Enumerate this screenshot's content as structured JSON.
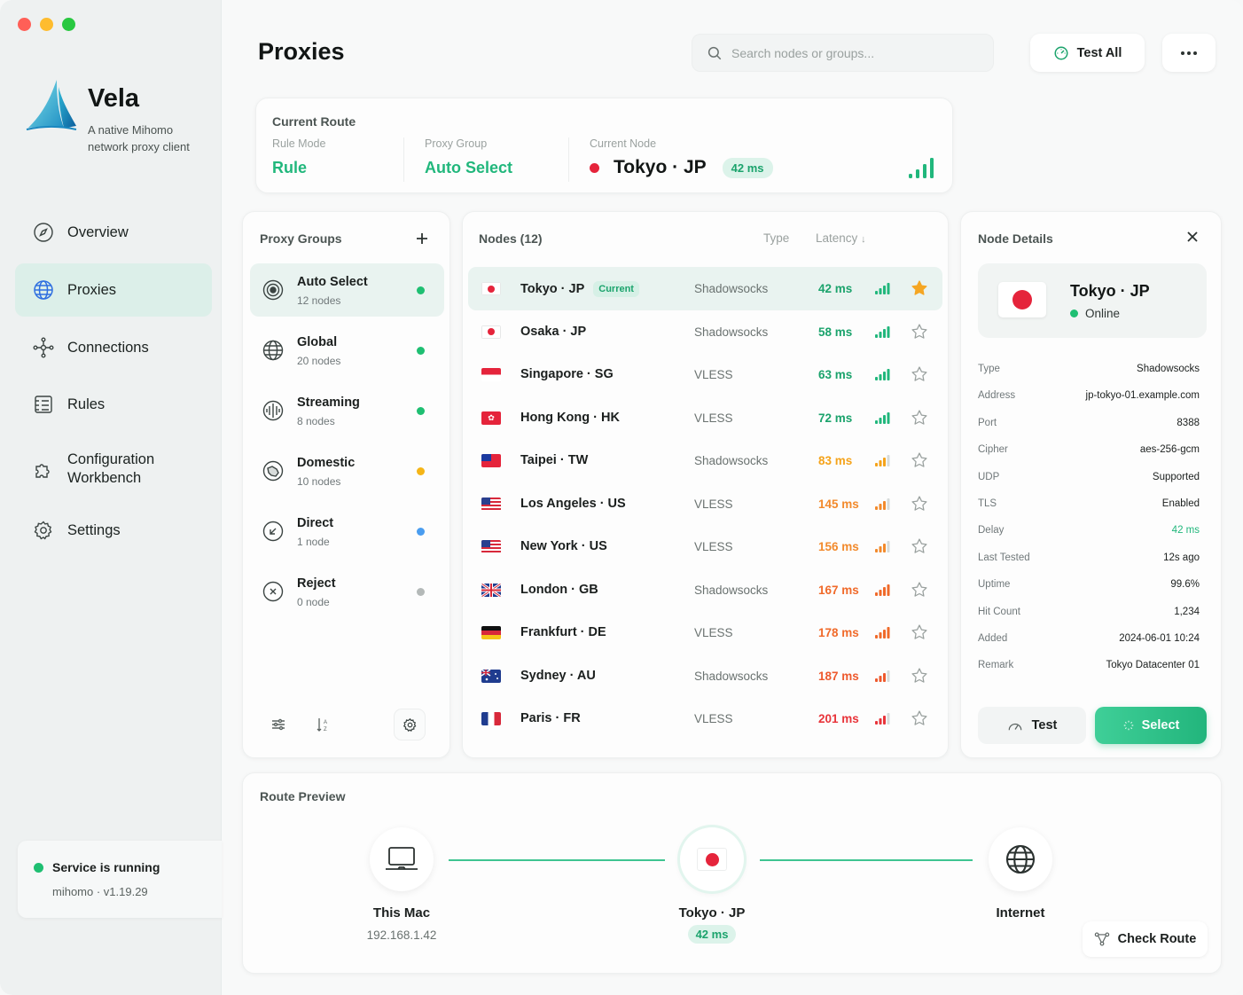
{
  "app": {
    "name": "Vela",
    "tagline": "A native Mihomo network proxy client"
  },
  "sidebar": {
    "items": [
      {
        "label": "Overview",
        "icon": "compass-icon"
      },
      {
        "label": "Proxies",
        "icon": "globe-icon"
      },
      {
        "label": "Connections",
        "icon": "network-icon"
      },
      {
        "label": "Rules",
        "icon": "list-icon"
      },
      {
        "label": "Configuration Workbench",
        "icon": "puzzle-icon"
      },
      {
        "label": "Settings",
        "icon": "gear-icon"
      }
    ],
    "active": "Proxies",
    "service": {
      "status": "Service is running",
      "version": "mihomo · v1.19.29"
    }
  },
  "header": {
    "title": "Proxies",
    "search_placeholder": "Search nodes or groups...",
    "test_all": "Test All"
  },
  "current_route": {
    "title": "Current Route",
    "rule_mode_label": "Rule Mode",
    "rule_mode": "Rule",
    "group_label": "Proxy Group",
    "group": "Auto Select",
    "node_label": "Current Node",
    "node": "Tokyo · JP",
    "latency": "42 ms"
  },
  "groups": {
    "title": "Proxy Groups",
    "items": [
      {
        "name": "Auto Select",
        "count": "12 nodes",
        "status_color": "#1fbf72"
      },
      {
        "name": "Global",
        "count": "20 nodes",
        "status_color": "#1fbf72"
      },
      {
        "name": "Streaming",
        "count": "8 nodes",
        "status_color": "#1fbf72"
      },
      {
        "name": "Domestic",
        "count": "10 nodes",
        "status_color": "#f5b517"
      },
      {
        "name": "Direct",
        "count": "1 node",
        "status_color": "#4a9df0"
      },
      {
        "name": "Reject",
        "count": "0 node",
        "status_color": "#b4b9b8"
      }
    ]
  },
  "nodes": {
    "title": "Nodes (12)",
    "col_type": "Type",
    "col_latency": "Latency",
    "current_tag": "Current",
    "items": [
      {
        "name": "Tokyo · JP",
        "flag": "jp",
        "type": "Shadowsocks",
        "latency": "42 ms",
        "color": "#1ba36c",
        "starred": true
      },
      {
        "name": "Osaka · JP",
        "flag": "jp",
        "type": "Shadowsocks",
        "latency": "58 ms",
        "color": "#1ba36c",
        "starred": false
      },
      {
        "name": "Singapore · SG",
        "flag": "sg",
        "type": "VLESS",
        "latency": "63 ms",
        "color": "#1ba36c",
        "starred": false
      },
      {
        "name": "Hong Kong · HK",
        "flag": "hk",
        "type": "VLESS",
        "latency": "72 ms",
        "color": "#1ba36c",
        "starred": false
      },
      {
        "name": "Taipei · TW",
        "flag": "tw",
        "type": "Shadowsocks",
        "latency": "83 ms",
        "color": "#f5a31a",
        "starred": false
      },
      {
        "name": "Los Angeles · US",
        "flag": "us",
        "type": "VLESS",
        "latency": "145 ms",
        "color": "#f28a2c",
        "starred": false
      },
      {
        "name": "New York · US",
        "flag": "us",
        "type": "VLESS",
        "latency": "156 ms",
        "color": "#f28a2c",
        "starred": false
      },
      {
        "name": "London · GB",
        "flag": "gb",
        "type": "Shadowsocks",
        "latency": "167 ms",
        "color": "#f06a2a",
        "starred": false
      },
      {
        "name": "Frankfurt · DE",
        "flag": "de",
        "type": "VLESS",
        "latency": "178 ms",
        "color": "#f06a2a",
        "starred": false
      },
      {
        "name": "Sydney · AU",
        "flag": "au",
        "type": "Shadowsocks",
        "latency": "187 ms",
        "color": "#ee5a2e",
        "starred": false
      },
      {
        "name": "Paris · FR",
        "flag": "fr",
        "type": "VLESS",
        "latency": "201 ms",
        "color": "#e8343a",
        "starred": false
      }
    ]
  },
  "details": {
    "title": "Node Details",
    "name": "Tokyo · JP",
    "status": "Online",
    "fields": [
      {
        "k": "Type",
        "v": "Shadowsocks"
      },
      {
        "k": "Address",
        "v": "jp-tokyo-01.example.com"
      },
      {
        "k": "Port",
        "v": "8388"
      },
      {
        "k": "Cipher",
        "v": "aes-256-gcm"
      },
      {
        "k": "UDP",
        "v": "Supported"
      },
      {
        "k": "TLS",
        "v": "Enabled"
      },
      {
        "k": "Delay",
        "v": "42 ms"
      },
      {
        "k": "Last Tested",
        "v": "12s ago"
      },
      {
        "k": "Uptime",
        "v": "99.6%"
      },
      {
        "k": "Hit Count",
        "v": "1,234"
      },
      {
        "k": "Added",
        "v": "2024-06-01 10:24"
      },
      {
        "k": "Remark",
        "v": "Tokyo Datacenter 01"
      }
    ],
    "test": "Test",
    "select": "Select"
  },
  "preview": {
    "title": "Route Preview",
    "source": "This Mac",
    "source_ip": "192.168.1.42",
    "node": "Tokyo · JP",
    "node_latency": "42 ms",
    "dest": "Internet",
    "check": "Check Route"
  },
  "colors": {
    "accent": "#21b77c",
    "brand_blue": "#2f6fe0"
  }
}
